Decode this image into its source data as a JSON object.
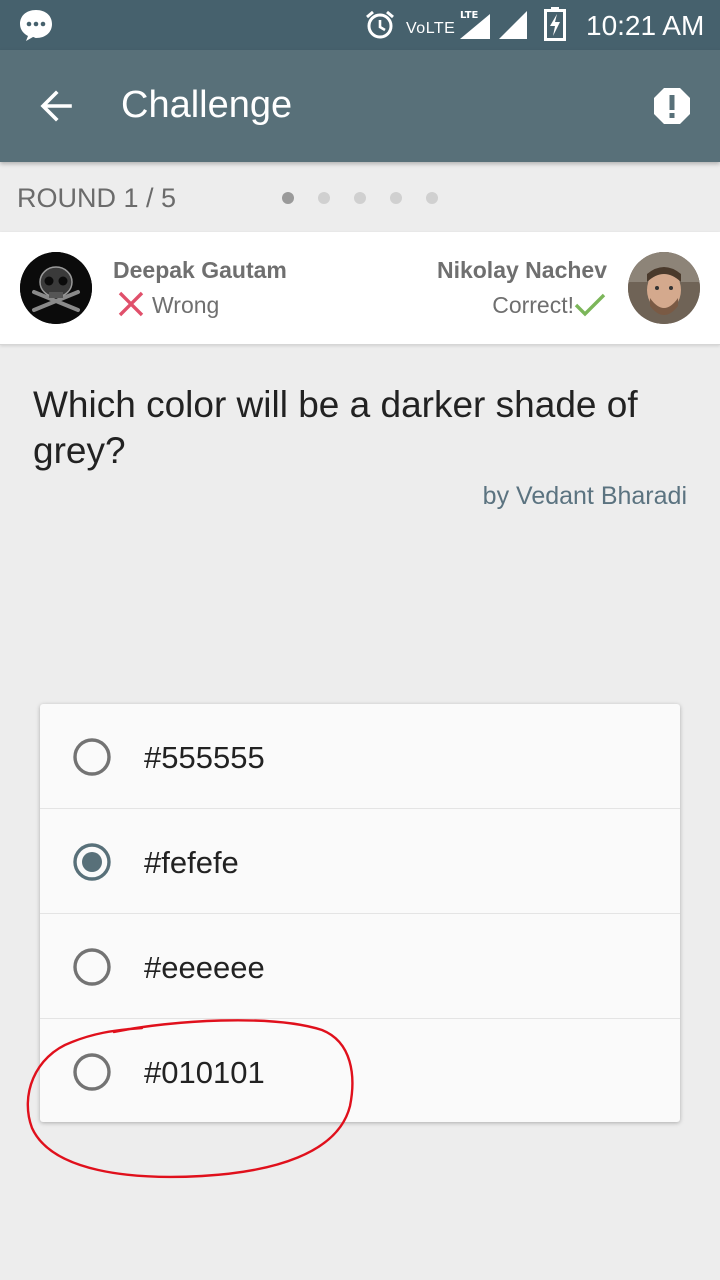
{
  "status_bar": {
    "network": "VoLTE",
    "lte": "LTE",
    "time": "10:21 AM",
    "icons": [
      "messenger-icon",
      "alarm-icon",
      "lte-signal-icon",
      "signal-icon",
      "battery-charging-icon"
    ]
  },
  "app_bar": {
    "title": "Challenge",
    "back_icon": "arrow-back-icon",
    "report_icon": "report-icon"
  },
  "round": {
    "label": "ROUND 1 / 5",
    "current": 1,
    "total": 5
  },
  "players": {
    "left": {
      "name": "Deepak Gautam",
      "result": "Wrong",
      "result_icon": "cross-icon",
      "result_color": "#e0506b"
    },
    "right": {
      "name": "Nikolay Nachev",
      "result": "Correct!",
      "result_icon": "check-icon",
      "result_color": "#7cb65a"
    }
  },
  "question": {
    "text": "Which color will be a darker shade of grey?",
    "author": "by Vedant Bharadi"
  },
  "options": [
    {
      "label": "#555555",
      "selected": false
    },
    {
      "label": "#fefefe",
      "selected": true
    },
    {
      "label": "#eeeeee",
      "selected": false
    },
    {
      "label": "#010101",
      "selected": false
    }
  ],
  "colors": {
    "status_bar": "#46616d",
    "app_bar": "#587079",
    "accent": "#5b7380",
    "annotation": "#e0101c"
  }
}
